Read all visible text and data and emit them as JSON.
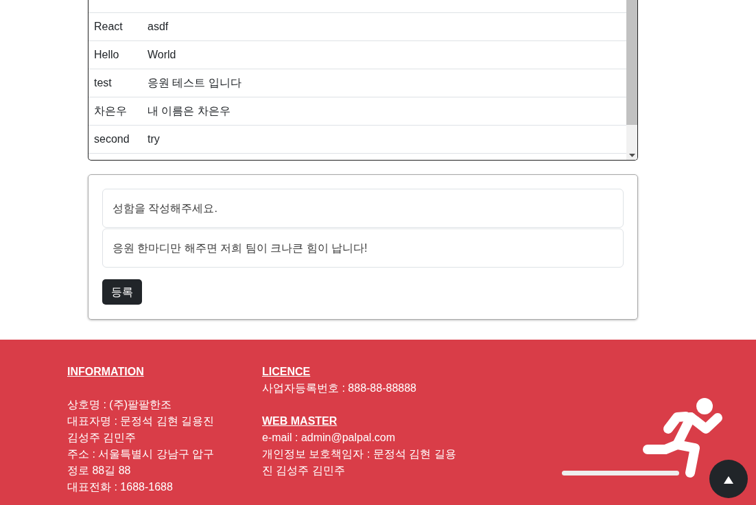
{
  "messages": [
    {
      "name": "React",
      "text": "asdf"
    },
    {
      "name": "Hello",
      "text": "World"
    },
    {
      "name": "test",
      "text": "응원 테스트 입니다"
    },
    {
      "name": "차은우",
      "text": "내 이름은 차은우"
    },
    {
      "name": "second",
      "text": "try"
    }
  ],
  "form": {
    "fields": [
      {
        "placeholder": "성함을 작성해주세요."
      },
      {
        "placeholder": "응원 한마디만 해주면 저희 팀이 크나큰 힘이 납니다!"
      }
    ],
    "submit_button": "등록"
  },
  "footer": {
    "information": {
      "heading": "INFORMATION",
      "lines": [
        "상호명 : (주)팔팔한조",
        "대표자명 : 문정석 김현 길용진 김성주 김민주",
        "주소 : 서울특별시 강남구 압구정로 88길 88",
        "대표전화 : 1688-1688"
      ]
    },
    "licence": {
      "heading": "LICENCE",
      "lines": [
        "사업자등록번호 : 888-88-88888"
      ]
    },
    "web_master": {
      "heading": "WEB MASTER",
      "lines": [
        "e-mail : admin@palpal.com",
        "개인정보 보호책임자 : 문정석 김현 길용진 김성주 김민주"
      ]
    }
  }
}
